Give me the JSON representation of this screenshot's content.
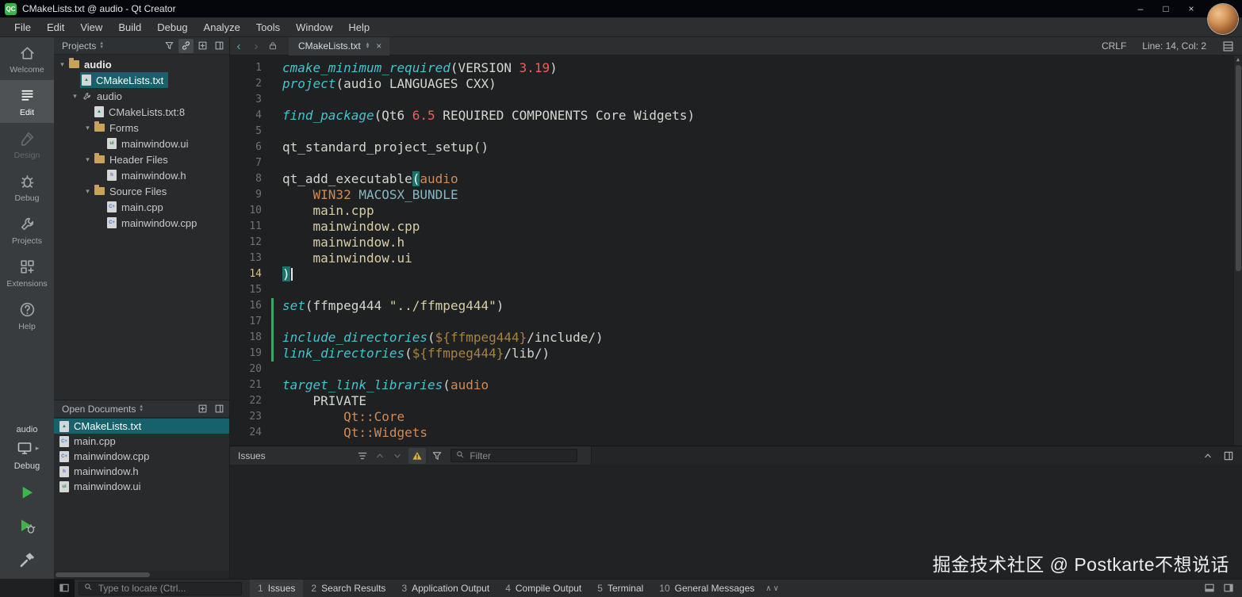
{
  "window": {
    "title": "CMakeLists.txt @ audio - Qt Creator",
    "logo_text": "QC",
    "controls": {
      "minimize": "–",
      "maximize": "□",
      "close": "×"
    }
  },
  "menubar": {
    "items": [
      "File",
      "Edit",
      "View",
      "Build",
      "Debug",
      "Analyze",
      "Tools",
      "Window",
      "Help"
    ]
  },
  "modebar": {
    "modes": [
      {
        "label": "Welcome",
        "icon": "welcome-icon",
        "state": "normal"
      },
      {
        "label": "Edit",
        "icon": "edit-icon",
        "state": "active"
      },
      {
        "label": "Design",
        "icon": "design-icon",
        "state": "disabled"
      },
      {
        "label": "Debug",
        "icon": "debug-icon",
        "state": "normal"
      },
      {
        "label": "Projects",
        "icon": "projects-icon",
        "state": "normal"
      },
      {
        "label": "Extensions",
        "icon": "extensions-icon",
        "state": "normal"
      },
      {
        "label": "Help",
        "icon": "help-icon",
        "state": "normal"
      }
    ],
    "target": {
      "project": "audio",
      "config": "Debug"
    }
  },
  "projects_pane": {
    "title": "Projects",
    "tree": [
      {
        "label": "audio",
        "level": 0,
        "icon": "folder",
        "expanded": true,
        "bold": true
      },
      {
        "label": "CMakeLists.txt",
        "level": 1,
        "icon": "cmake",
        "selected": true
      },
      {
        "label": "audio",
        "level": 1,
        "icon": "wrench",
        "expanded": true
      },
      {
        "label": "CMakeLists.txt:8",
        "level": 2,
        "icon": "cmake"
      },
      {
        "label": "Forms",
        "level": 2,
        "icon": "folder",
        "expanded": true
      },
      {
        "label": "mainwindow.ui",
        "level": 3,
        "icon": "ui"
      },
      {
        "label": "Header Files",
        "level": 2,
        "icon": "folder",
        "expanded": true
      },
      {
        "label": "mainwindow.h",
        "level": 3,
        "icon": "h"
      },
      {
        "label": "Source Files",
        "level": 2,
        "icon": "folder",
        "expanded": true
      },
      {
        "label": "main.cpp",
        "level": 3,
        "icon": "cpp"
      },
      {
        "label": "mainwindow.cpp",
        "level": 3,
        "icon": "cpp"
      }
    ]
  },
  "docs_pane": {
    "title": "Open Documents",
    "items": [
      {
        "label": "CMakeLists.txt",
        "icon": "cmake",
        "selected": true
      },
      {
        "label": "main.cpp",
        "icon": "cpp"
      },
      {
        "label": "mainwindow.cpp",
        "icon": "cpp"
      },
      {
        "label": "mainwindow.h",
        "icon": "h"
      },
      {
        "label": "mainwindow.ui",
        "icon": "ui"
      }
    ]
  },
  "editor": {
    "tab_title": "CMakeLists.txt",
    "status": {
      "line_ending": "CRLF",
      "cursor_position": "Line: 14, Col: 2"
    },
    "current_line": 14,
    "changed_lines": [
      16,
      17,
      18,
      19
    ],
    "lines": [
      {
        "n": 1,
        "segs": [
          [
            "cmd",
            "cmake_minimum_required"
          ],
          [
            "plain",
            "(VERSION "
          ],
          [
            "num",
            "3.19"
          ],
          [
            "plain",
            ")"
          ]
        ]
      },
      {
        "n": 2,
        "segs": [
          [
            "cmd",
            "project"
          ],
          [
            "plain",
            "(audio LANGUAGES CXX)"
          ]
        ]
      },
      {
        "n": 3,
        "segs": []
      },
      {
        "n": 4,
        "segs": [
          [
            "cmd",
            "find_package"
          ],
          [
            "plain",
            "(Qt6 "
          ],
          [
            "num",
            "6.5"
          ],
          [
            "plain",
            " REQUIRED COMPONENTS Core Widgets)"
          ]
        ]
      },
      {
        "n": 5,
        "segs": []
      },
      {
        "n": 6,
        "segs": [
          [
            "plain",
            "qt_standard_project_setup()"
          ]
        ]
      },
      {
        "n": 7,
        "segs": []
      },
      {
        "n": 8,
        "segs": [
          [
            "plain",
            "qt_add_executable"
          ],
          [
            "match",
            "("
          ],
          [
            "arg",
            "audio"
          ]
        ]
      },
      {
        "n": 9,
        "segs": [
          [
            "plain",
            "    "
          ],
          [
            "arg",
            "WIN32"
          ],
          [
            "plain",
            " "
          ],
          [
            "kw2",
            "MACOSX_BUNDLE"
          ]
        ]
      },
      {
        "n": 10,
        "segs": [
          [
            "plain",
            "    "
          ],
          [
            "file",
            "main.cpp"
          ]
        ]
      },
      {
        "n": 11,
        "segs": [
          [
            "plain",
            "    "
          ],
          [
            "file",
            "mainwindow.cpp"
          ]
        ]
      },
      {
        "n": 12,
        "segs": [
          [
            "plain",
            "    "
          ],
          [
            "file",
            "mainwindow.h"
          ]
        ]
      },
      {
        "n": 13,
        "segs": [
          [
            "plain",
            "    "
          ],
          [
            "file",
            "mainwindow.ui"
          ]
        ]
      },
      {
        "n": 14,
        "segs": [
          [
            "match",
            ")"
          ]
        ]
      },
      {
        "n": 15,
        "segs": []
      },
      {
        "n": 16,
        "segs": [
          [
            "cmd",
            "set"
          ],
          [
            "plain",
            "(ffmpeg444 "
          ],
          [
            "str",
            "\"../ffmpeg444\""
          ],
          [
            "plain",
            ")"
          ]
        ]
      },
      {
        "n": 17,
        "segs": []
      },
      {
        "n": 18,
        "segs": [
          [
            "cmd",
            "include_directories"
          ],
          [
            "plain",
            "("
          ],
          [
            "var",
            "${ffmpeg444}"
          ],
          [
            "plain",
            "/include/)"
          ]
        ]
      },
      {
        "n": 19,
        "segs": [
          [
            "cmd",
            "link_directories"
          ],
          [
            "plain",
            "("
          ],
          [
            "var",
            "${ffmpeg444}"
          ],
          [
            "plain",
            "/lib/)"
          ]
        ]
      },
      {
        "n": 20,
        "segs": []
      },
      {
        "n": 21,
        "segs": [
          [
            "cmd",
            "target_link_libraries"
          ],
          [
            "plain",
            "("
          ],
          [
            "arg",
            "audio"
          ]
        ]
      },
      {
        "n": 22,
        "segs": [
          [
            "plain",
            "    PRIVATE"
          ]
        ]
      },
      {
        "n": 23,
        "segs": [
          [
            "plain",
            "        "
          ],
          [
            "arg",
            "Qt::Core"
          ]
        ]
      },
      {
        "n": 24,
        "segs": [
          [
            "plain",
            "        "
          ],
          [
            "arg",
            "Qt::Widgets"
          ]
        ]
      }
    ]
  },
  "issues_pane": {
    "title": "Issues",
    "filter_placeholder": "Filter"
  },
  "bottombar": {
    "locator_placeholder": "Type to locate (Ctrl...",
    "outputs": [
      {
        "num": "1",
        "label": "Issues",
        "active": true
      },
      {
        "num": "2",
        "label": "Search Results"
      },
      {
        "num": "3",
        "label": "Application Output"
      },
      {
        "num": "4",
        "label": "Compile Output"
      },
      {
        "num": "5",
        "label": "Terminal"
      },
      {
        "num": "10",
        "label": "General Messages"
      }
    ]
  },
  "watermark": "掘金技术社区 @ Postkarte不想说话",
  "colors": {
    "accent_teal": "#17616d",
    "command": "#43c3cf",
    "number": "#ef5e5e",
    "argument": "#d08a54",
    "string": "#d9cfa5",
    "variable": "#a8823f",
    "changed_line_marker": "#3fa65b",
    "run_green": "#3db54a",
    "warning_yellow": "#dfae3d"
  }
}
